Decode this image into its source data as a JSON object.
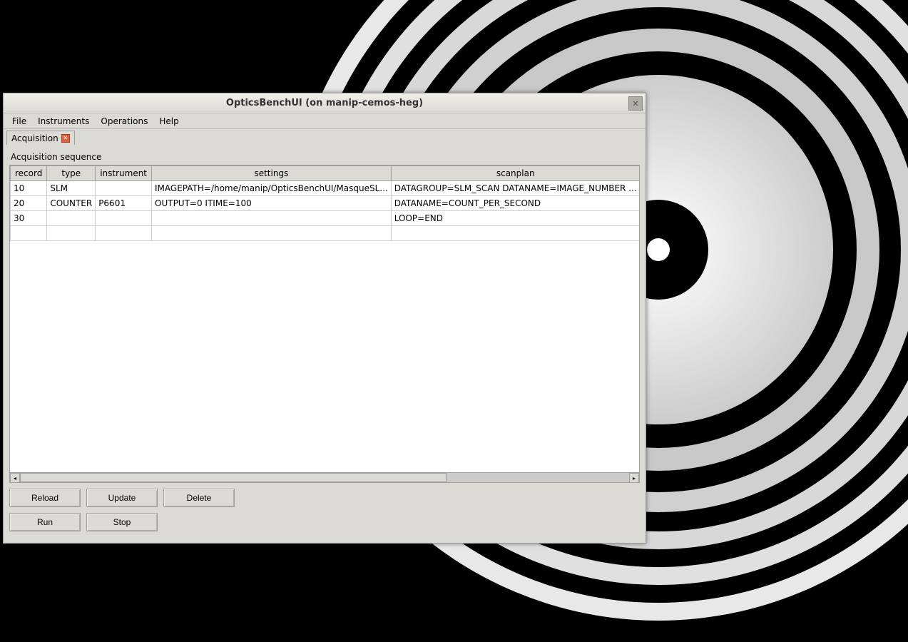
{
  "window": {
    "title": "OpticsBenchUI (on manip-cemos-heg)"
  },
  "menubar": {
    "file": "File",
    "instruments": "Instruments",
    "operations": "Operations",
    "help": "Help"
  },
  "tab": {
    "label": "Acquisition"
  },
  "section": {
    "label": "Acquisition sequence"
  },
  "table": {
    "headers": {
      "record": "record",
      "type": "type",
      "instrument": "instrument",
      "settings": "settings",
      "scanplan": "scanplan"
    },
    "rows": [
      {
        "record": "10",
        "type": "SLM",
        "instrument": "",
        "settings": "IMAGEPATH=/home/manip/OpticsBenchUI/MasqueSL...",
        "scanplan": "DATAGROUP=SLM_SCAN  DATANAME=IMAGE_NUMBER ..."
      },
      {
        "record": "20",
        "type": "COUNTER",
        "instrument": "P6601",
        "settings": "OUTPUT=0 ITIME=100",
        "scanplan": "DATANAME=COUNT_PER_SECOND"
      },
      {
        "record": "30",
        "type": "",
        "instrument": "",
        "settings": "",
        "scanplan": "LOOP=END"
      },
      {
        "record": "",
        "type": "",
        "instrument": "",
        "settings": "",
        "scanplan": ""
      }
    ]
  },
  "buttons": {
    "reload": "Reload",
    "update": "Update",
    "delete": "Delete",
    "run": "Run",
    "stop": "Stop"
  }
}
